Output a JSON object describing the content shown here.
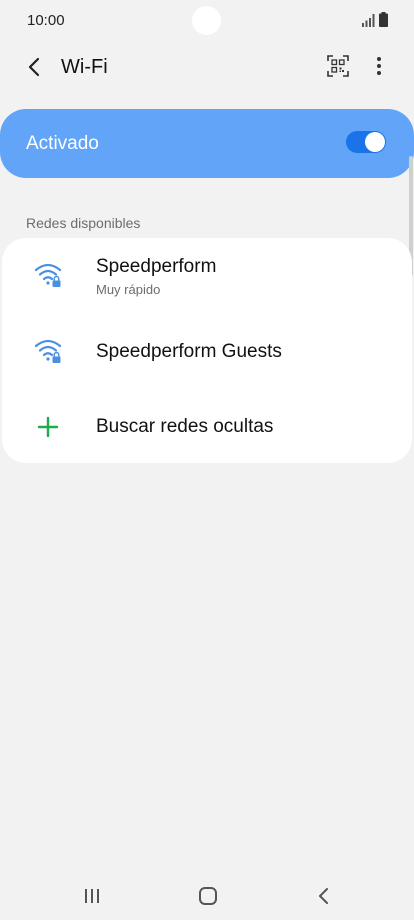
{
  "status_bar": {
    "time": "10:00",
    "icons": [
      "signal-icon",
      "battery-icon"
    ]
  },
  "app_bar": {
    "title": "Wi-Fi",
    "icons": [
      "back-icon",
      "qr-code-scan-icon",
      "more-options-icon"
    ]
  },
  "master_toggle": {
    "label": "Activado",
    "state": "on"
  },
  "available_networks": {
    "header": "Redes disponibles",
    "items": [
      {
        "name": "Speedperform",
        "subtitle": "Muy rápido",
        "icon": "wifi-locked-icon"
      },
      {
        "name": "Speedperform Guests",
        "subtitle": "",
        "icon": "wifi-locked-icon"
      },
      {
        "name": "Buscar redes ocultas",
        "subtitle": "",
        "icon": "plus-icon"
      }
    ]
  },
  "nav_bar": {
    "icons": [
      "recent-apps-icon",
      "home-icon",
      "nav-back-icon"
    ]
  },
  "colors": {
    "background": "#f2f2f2",
    "toggle_card": "#62a4f7",
    "switch_track": "#1a73e8",
    "wifi_icon": "#4a90e2",
    "plus_icon": "#1eaa4a"
  }
}
